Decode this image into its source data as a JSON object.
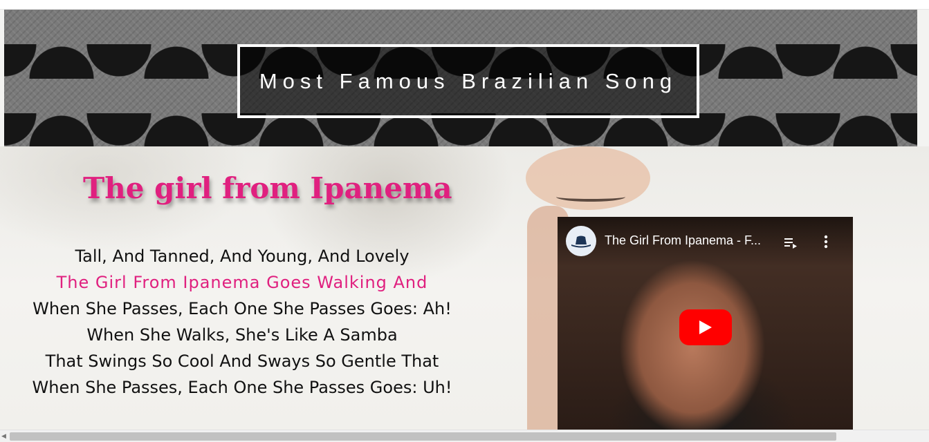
{
  "banner": {
    "title": "Most Famous Brazilian Song"
  },
  "main": {
    "song_title": "The girl from Ipanema",
    "lyrics": [
      "Tall, And Tanned, And Young, And Lovely",
      "The Girl From Ipanema Goes Walking And",
      "When She Passes, Each One She Passes Goes: Ah!",
      "When She Walks, She's Like A Samba",
      "That Swings So Cool And Sways So Gentle That",
      "When She Passes, Each One She Passes Goes: Uh!"
    ]
  },
  "video": {
    "title": "The Girl From Ipanema - F...",
    "icons": [
      "channel-avatar-icon",
      "playlist-icon",
      "more-vert-icon",
      "play-icon"
    ],
    "play_color": "#ff0000"
  },
  "colors": {
    "accent_pink": "#e0207f",
    "link_blue": "#3a6fd8"
  }
}
